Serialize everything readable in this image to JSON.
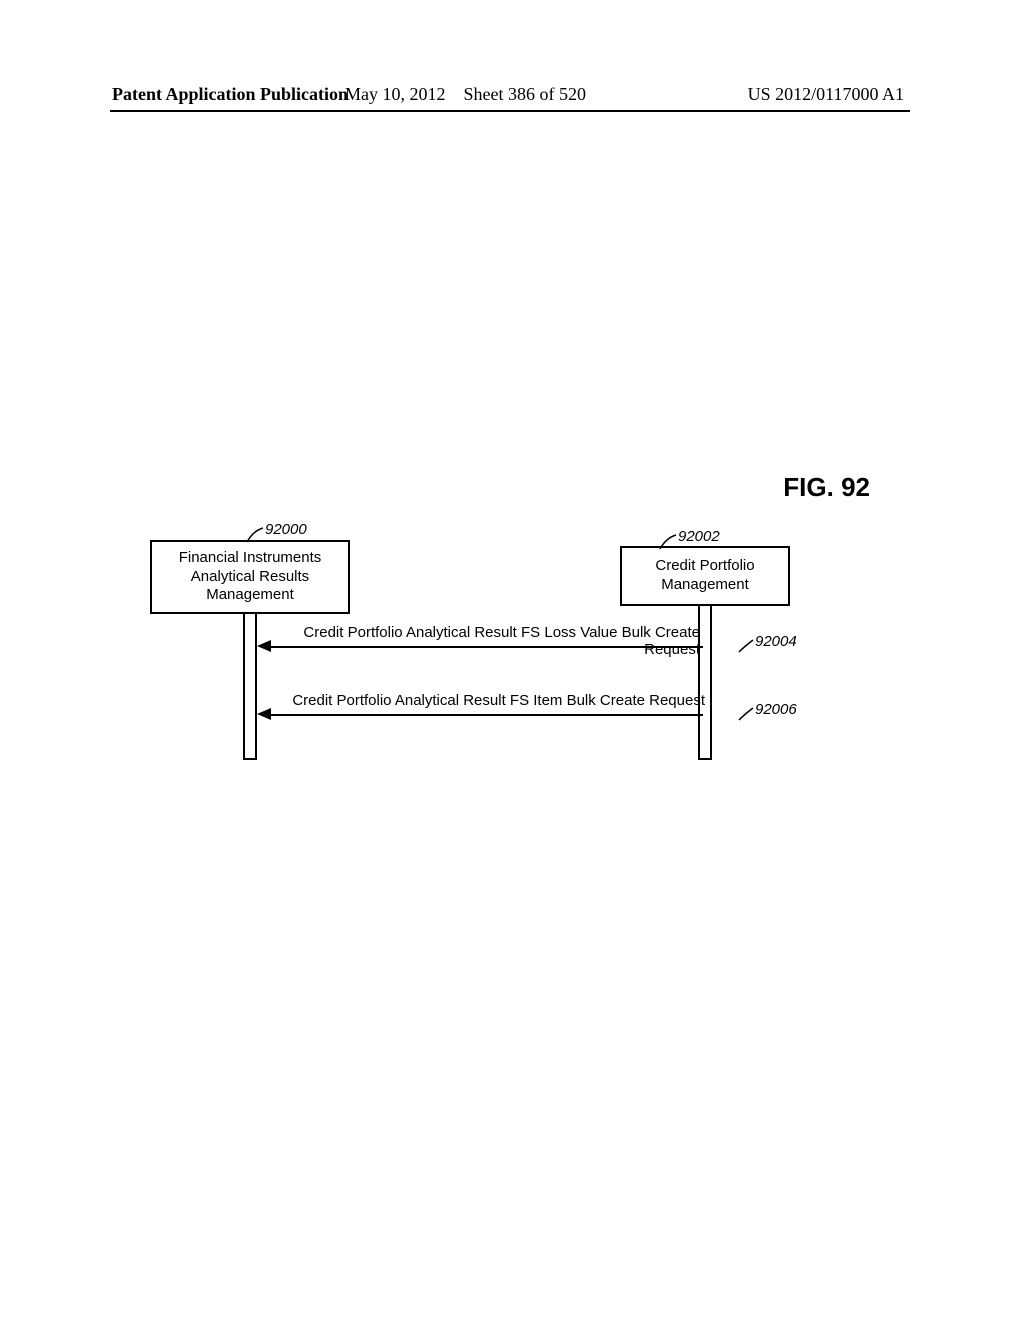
{
  "header": {
    "left": "Patent Application Publication",
    "date": "May 10, 2012",
    "sheet": "Sheet 386 of 520",
    "pubno": "US 2012/0117000 A1"
  },
  "figure": {
    "title": "FIG. 92",
    "blocks": {
      "left": {
        "label": "Financial Instruments\nAnalytical Results\nManagement",
        "ref": "92000"
      },
      "right": {
        "label": "Credit Portfolio\nManagement",
        "ref": "92002"
      }
    },
    "messages": [
      {
        "text": "Credit Portfolio Analytical Result FS Loss Value Bulk Create Request",
        "ref": "92004"
      },
      {
        "text": "Credit Portfolio Analytical Result FS Item Bulk Create Request",
        "ref": "92006"
      }
    ]
  }
}
